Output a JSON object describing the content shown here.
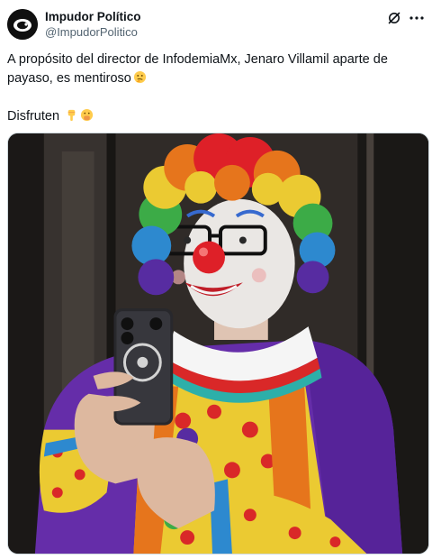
{
  "header": {
    "display_name": "Impudor Político",
    "handle": "@ImpudorPolitico",
    "grok_icon": "grok-icon",
    "more_icon": "more-horizontal-icon"
  },
  "tweet": {
    "line1": "A propósito del director de InfodemiaMx, Jenaro Villamil aparte de payaso, es mentiroso",
    "line1_emoji": "thinking-face-emoji",
    "line2": "Disfruten",
    "line2_emojis": [
      "pointing-down-emoji",
      "face-with-hand-over-mouth-emoji"
    ]
  },
  "media": {
    "icon": "clown-selfie-photo",
    "accent": "#ff2d2d"
  }
}
